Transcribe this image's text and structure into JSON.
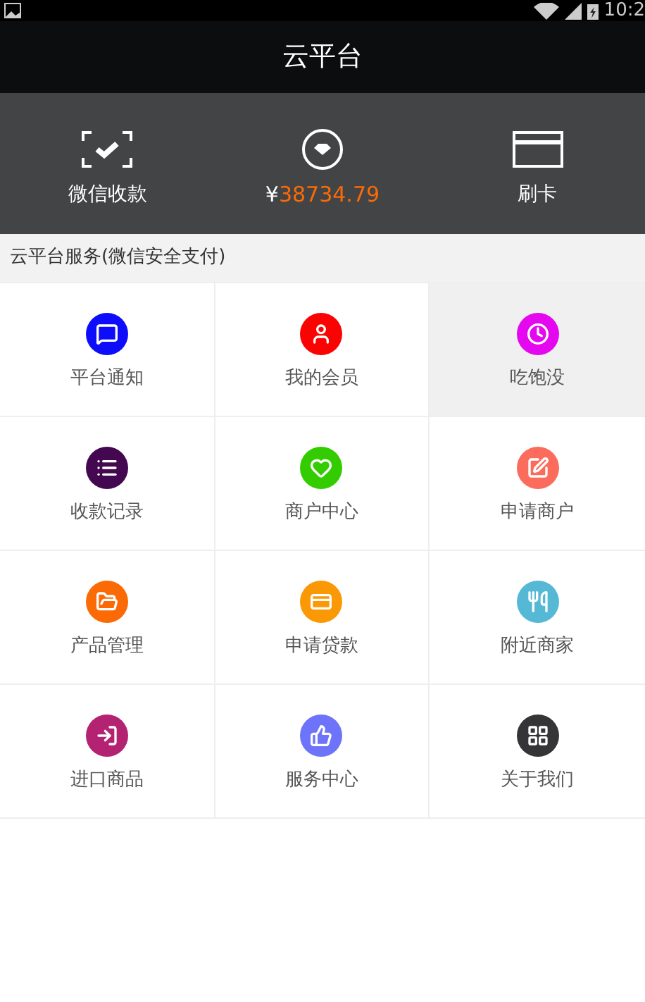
{
  "status_bar": {
    "time": "10:2"
  },
  "header": {
    "title": "云平台"
  },
  "top_actions": [
    {
      "kind": "scan",
      "label": "微信收款"
    },
    {
      "kind": "balance",
      "currency": "¥",
      "amount": "38734.79"
    },
    {
      "kind": "card",
      "label": "刷卡"
    }
  ],
  "section": {
    "title": "云平台服务(微信安全支付)"
  },
  "items": [
    {
      "kind": "chat",
      "label": "平台通知",
      "color": "#0d0dfb",
      "selected": false
    },
    {
      "kind": "user",
      "label": "我的会员",
      "color": "#fb0303",
      "selected": false
    },
    {
      "kind": "clock",
      "label": "吃饱没",
      "color": "#e407f0",
      "selected": true
    },
    {
      "kind": "list",
      "label": "收款记录",
      "color": "#43084f",
      "selected": false
    },
    {
      "kind": "heart",
      "label": "商户中心",
      "color": "#33cc00",
      "selected": false
    },
    {
      "kind": "edit",
      "label": "申请商户",
      "color": "#fb6c5c",
      "selected": false
    },
    {
      "kind": "folder",
      "label": "产品管理",
      "color": "#fb6a05",
      "selected": false
    },
    {
      "kind": "card",
      "label": "申请贷款",
      "color": "#fb9805",
      "selected": false
    },
    {
      "kind": "utensils",
      "label": "附近商家",
      "color": "#55b9d6",
      "selected": false
    },
    {
      "kind": "login",
      "label": "进口商品",
      "color": "#b32372",
      "selected": false
    },
    {
      "kind": "hand",
      "label": "服务中心",
      "color": "#6e74f9",
      "selected": false
    },
    {
      "kind": "grid",
      "label": "关于我们",
      "color": "#353537",
      "selected": false
    }
  ]
}
